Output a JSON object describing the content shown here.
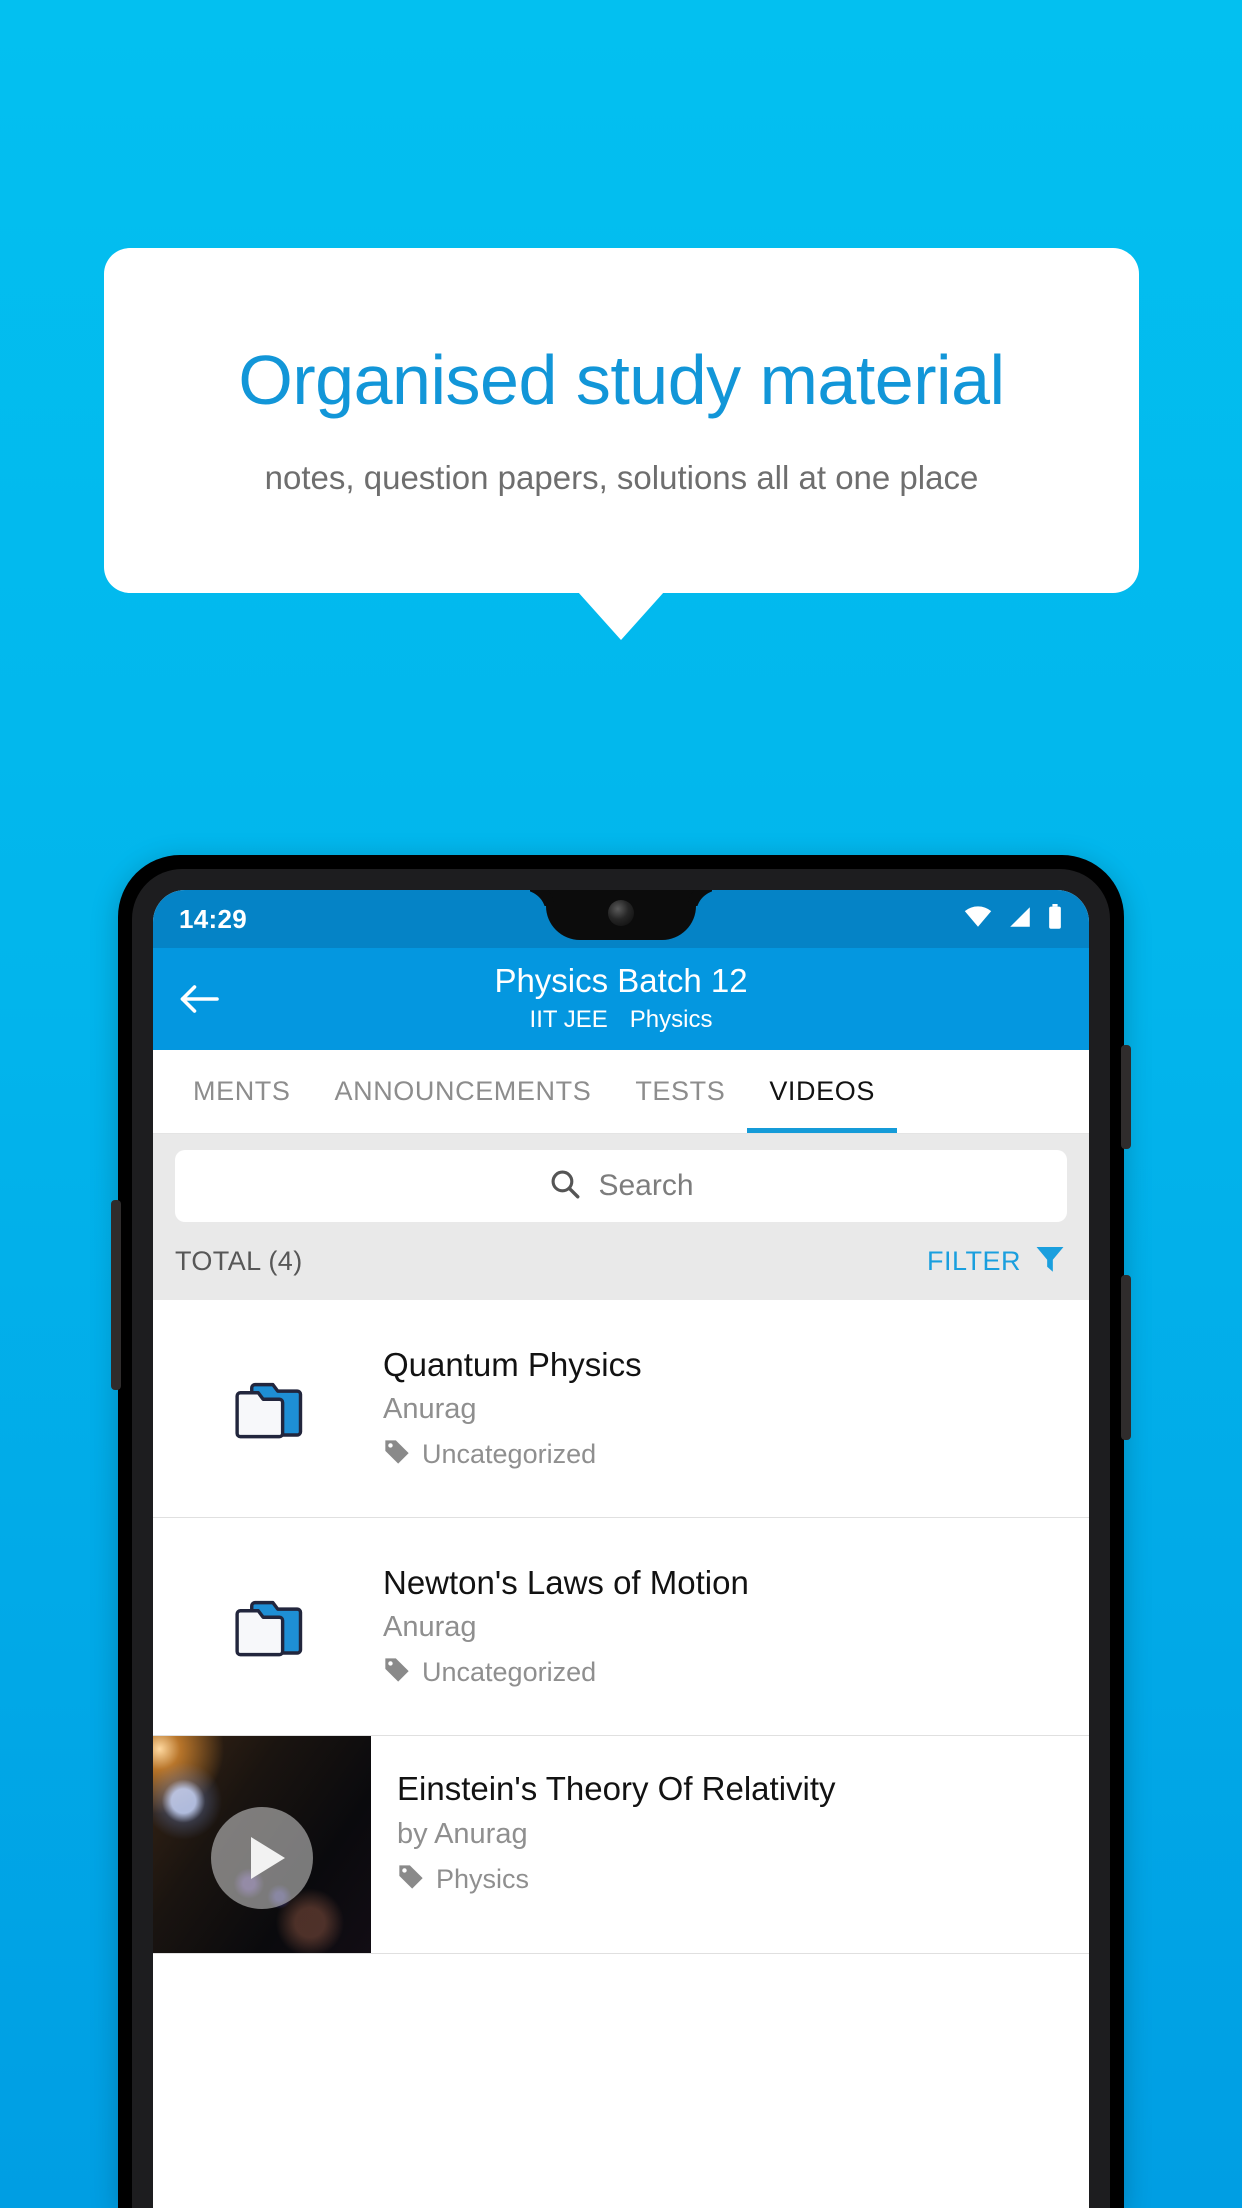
{
  "promo": {
    "title": "Organised study material",
    "subtitle": "notes, question papers, solutions all at one place",
    "title_color": "#1296D8",
    "subtitle_color": "#6E6E6E",
    "background_color": "#03C0F0"
  },
  "phone": {
    "statusbar": {
      "time": "14:29",
      "icons": [
        "wifi-icon",
        "signal-icon",
        "battery-icon"
      ],
      "background_color": "#0583C6"
    },
    "appbar": {
      "back_icon": "back-arrow-icon",
      "title": "Physics Batch 12",
      "subtitle_exam": "IIT JEE",
      "subtitle_subject": "Physics",
      "background_color": "#0497E0"
    },
    "tabs": {
      "items": [
        {
          "label": "MENTS",
          "active": false
        },
        {
          "label": "ANNOUNCEMENTS",
          "active": false
        },
        {
          "label": "TESTS",
          "active": false
        },
        {
          "label": "VIDEOS",
          "active": true
        }
      ],
      "indicator_color": "#159BD8"
    },
    "search": {
      "icon": "search-icon",
      "placeholder": "Search",
      "value": ""
    },
    "toolbar": {
      "total_label": "TOTAL (4)",
      "filter_label": "FILTER",
      "filter_icon": "filter-funnel-icon",
      "filter_color": "#1A9FDE"
    },
    "list": {
      "items": [
        {
          "icon": "folder-icon",
          "title": "Quantum Physics",
          "author": "Anurag",
          "tag_icon": "tag-icon",
          "tag": "Uncategorized",
          "type": "folder"
        },
        {
          "icon": "folder-icon",
          "title": "Newton's Laws of Motion",
          "author": "Anurag",
          "tag_icon": "tag-icon",
          "tag": "Uncategorized",
          "type": "folder"
        },
        {
          "icon": "video-thumbnail",
          "play_icon": "play-icon",
          "title": "Einstein's Theory Of Relativity",
          "author": "by Anurag",
          "tag_icon": "tag-icon",
          "tag": "Physics",
          "type": "video"
        }
      ]
    }
  }
}
